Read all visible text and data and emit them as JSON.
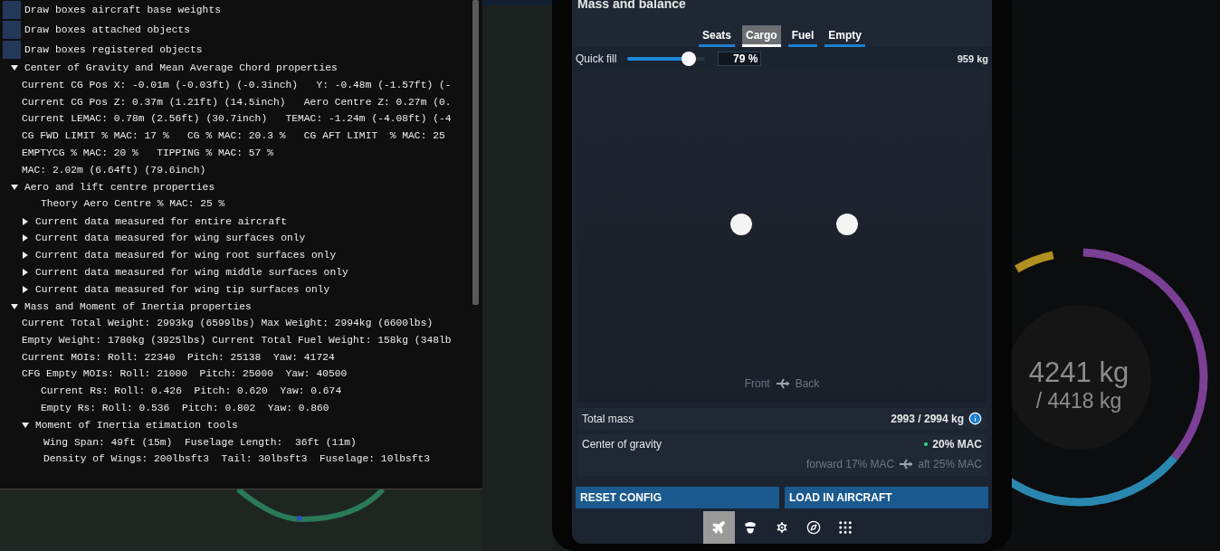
{
  "debug_panel": {
    "items": [
      {
        "kind": "checkbox",
        "label": "Draw boxes aircraft base weights",
        "checked": false
      },
      {
        "kind": "checkbox",
        "label": "Draw boxes attached objects",
        "checked": false
      },
      {
        "kind": "checkbox",
        "label": "Draw boxes registered objects",
        "checked": false
      },
      {
        "kind": "node",
        "label": "Center of Gravity and Mean Average Chord properties",
        "expanded": true,
        "children": [
          {
            "kind": "text",
            "label": "Current CG Pos X: -0.01m (-0.03ft) (-0.3inch)   Y: -0.48m (-1.57ft) (-"
          },
          {
            "kind": "text",
            "label": "Current CG Pos Z: 0.37m (1.21ft) (14.5inch)   Aero Centre Z: 0.27m (0."
          },
          {
            "kind": "text",
            "label": "Current LEMAC: 0.78m (2.56ft) (30.7inch)   TEMAC: -1.24m (-4.08ft) (-4"
          },
          {
            "kind": "text",
            "label": "CG FWD LIMIT % MAC: 17 %   CG % MAC: 20.3 %   CG AFT LIMIT  % MAC: 25"
          },
          {
            "kind": "text",
            "label": "EMPTYCG % MAC: 20 %   TIPPING % MAC: 57 %"
          },
          {
            "kind": "text",
            "label": "MAC: 2.02m (6.64ft) (79.6inch)"
          }
        ]
      },
      {
        "kind": "node",
        "label": "Aero and lift centre properties",
        "expanded": true,
        "children": [
          {
            "kind": "detail",
            "label": "Theory Aero Centre % MAC: 25 %"
          },
          {
            "kind": "node",
            "label": "Current data measured for entire aircraft",
            "expanded": false
          },
          {
            "kind": "node",
            "label": "Current data measured for wing surfaces only",
            "expanded": false
          },
          {
            "kind": "node",
            "label": "Current data measured for wing root surfaces only",
            "expanded": false
          },
          {
            "kind": "node",
            "label": "Current data measured for wing middle surfaces only",
            "expanded": false
          },
          {
            "kind": "node",
            "label": "Current data measured for wing tip surfaces only",
            "expanded": false
          }
        ]
      },
      {
        "kind": "node",
        "label": "Mass and Moment of Inertia properties",
        "expanded": true,
        "children": [
          {
            "kind": "text",
            "label": "Current Total Weight: 2993kg (6599lbs) Max Weight: 2994kg (6600lbs)"
          },
          {
            "kind": "text",
            "label": "Empty Weight: 1780kg (3925lbs) Current Total Fuel Weight: 158kg (348lb"
          },
          {
            "kind": "text",
            "label": "Current MOIs: Roll: 22340  Pitch: 25138  Yaw: 41724"
          },
          {
            "kind": "text",
            "label": "CFG Empty MOIs: Roll: 21000  Pitch: 25000  Yaw: 40500"
          },
          {
            "kind": "detail",
            "label": "Current Rs: Roll: 0.426  Pitch: 0.620  Yaw: 0.674"
          },
          {
            "kind": "detail",
            "label": "Empty Rs: Roll: 0.536  Pitch: 0.802  Yaw: 0.860"
          },
          {
            "kind": "node",
            "label": "Moment of Inertia etimation tools",
            "expanded": true,
            "children": [
              {
                "kind": "text",
                "label": "Wing Span: 49ft (15m)  Fuselage Length:  36ft (11m)"
              },
              {
                "kind": "text",
                "label": "Density of Wings: 200lbsft3  Tail: 30lbsft3  Fuselage: 10lbsft3"
              }
            ]
          }
        ]
      }
    ]
  },
  "tablet": {
    "title": "Mass and balance",
    "tabs": [
      {
        "label": "Seats",
        "selected": false
      },
      {
        "label": "Cargo",
        "selected": true
      },
      {
        "label": "Fuel",
        "selected": false
      },
      {
        "label": "Empty",
        "selected": false
      }
    ],
    "quick_fill": {
      "label": "Quick fill",
      "level": 0.79,
      "value": "79 %",
      "mass": "959 kg"
    },
    "layout": {
      "front": "Front",
      "back": "Back"
    },
    "total_mass": {
      "label": "Total mass",
      "value": "2993 / 2994 kg"
    },
    "center_of_gravity": {
      "label": "Center of gravity",
      "value": "20% MAC",
      "forward": "forward 17% MAC",
      "aft": "aft 25% MAC"
    },
    "buttons": [
      "RESET CONFIG",
      "LOAD IN AIRCRAFT"
    ],
    "nav": [
      {
        "kind": "plane",
        "selected": true
      },
      {
        "kind": "pilot",
        "selected": false
      },
      {
        "kind": "settings",
        "selected": false
      },
      {
        "kind": "compass",
        "selected": false
      },
      {
        "kind": "apps",
        "selected": false
      }
    ]
  },
  "gauge": {
    "value": "4241 kg",
    "total": "/ 4418 kg"
  }
}
